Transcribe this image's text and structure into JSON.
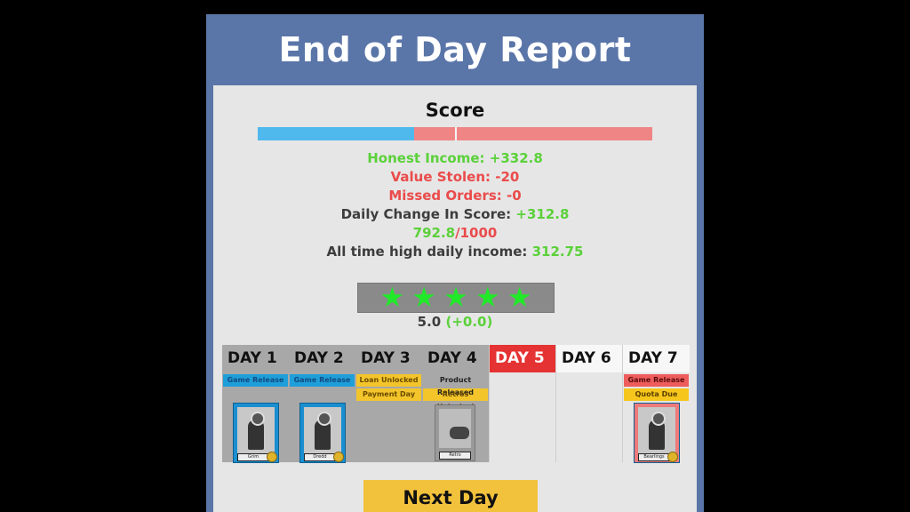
{
  "title": "End of Day Report",
  "score": {
    "heading": "Score",
    "bar_fractions": {
      "blue": 0.396,
      "red_small": 0.104,
      "red_large": 0.5
    },
    "colors": {
      "blue": "#4fb8ec",
      "red": "#f08585"
    }
  },
  "stats": {
    "honest_income": "Honest Income: +332.8",
    "value_stolen": "Value Stolen: -20",
    "missed_orders": "Missed Orders: -0",
    "daily_change_label": "Daily Change In Score: ",
    "daily_change_value": "+312.8",
    "total_current": "792.8",
    "total_sep_max": "/1000",
    "all_time_label": "All time high daily income: ",
    "all_time_value": "312.75"
  },
  "rating": {
    "stars": 5,
    "star_glyph": "★",
    "value": "5.0",
    "change": "(+0.0)"
  },
  "days": [
    {
      "label": "DAY 1",
      "state": "past",
      "events": [
        {
          "text": "Game Release",
          "color": "blue"
        }
      ],
      "card": {
        "type": "game",
        "label": "Grim",
        "bg": "#1a8fd0"
      }
    },
    {
      "label": "DAY 2",
      "state": "past",
      "events": [
        {
          "text": "Game Release",
          "color": "blue"
        }
      ],
      "card": {
        "type": "game",
        "label": "Dredd",
        "bg": "#1a8fd0"
      }
    },
    {
      "label": "DAY 3",
      "state": "past",
      "events": [
        {
          "text": "Loan Unlocked",
          "color": "yellow"
        },
        {
          "text": "Payment Day",
          "color": "yellow"
        }
      ],
      "card": null
    },
    {
      "label": "DAY 4",
      "state": "past",
      "events": [
        {
          "text": "Product Released",
          "color": "grey"
        },
        {
          "text": "Retros Unlocked",
          "color": "yellow"
        }
      ],
      "card": {
        "type": "product",
        "label": "Retro",
        "bg": "#9a9a9a"
      }
    },
    {
      "label": "DAY 5",
      "state": "current",
      "events": [],
      "card": null
    },
    {
      "label": "DAY 6",
      "state": "future",
      "events": [],
      "card": null
    },
    {
      "label": "DAY 7",
      "state": "future",
      "events": [
        {
          "text": "Game Release",
          "color": "red"
        },
        {
          "text": "Quota Due",
          "color": "gold"
        }
      ],
      "card": {
        "type": "game",
        "label": "Bearlings",
        "bg": "#ee7a7a"
      }
    }
  ],
  "next_button": "Next Day"
}
